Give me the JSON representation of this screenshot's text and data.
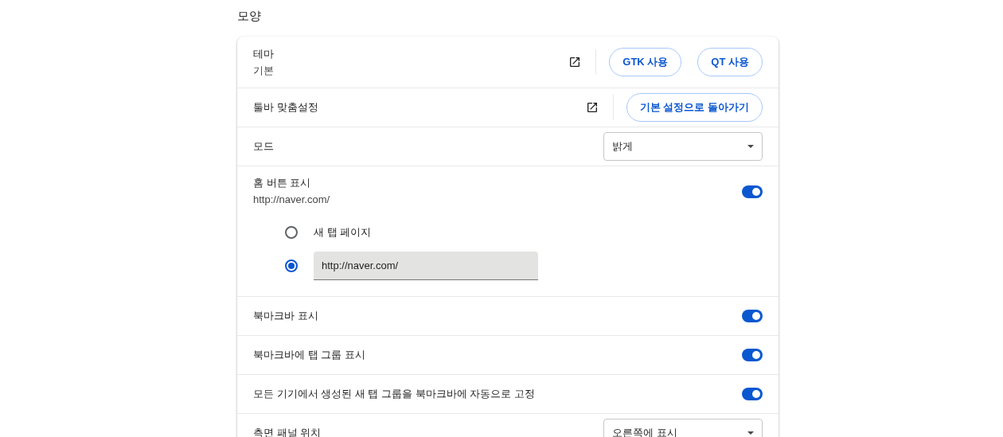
{
  "section_title": "모양",
  "rows": [
    {
      "kind": "links",
      "label": "테마",
      "sublabel": "기본",
      "buttons": [
        "GTK 사용",
        "QT 사용"
      ]
    },
    {
      "kind": "links",
      "label": "툴바 맞춤설정",
      "buttons": [
        "기본 설정으로 돌아가기"
      ]
    },
    {
      "kind": "select",
      "label": "모드",
      "value": "밝게"
    },
    {
      "kind": "toggle",
      "label": "홈 버튼 표시",
      "sublabel": "http://naver.com/",
      "on": true,
      "options": [
        {
          "kind": "radio",
          "label": "새 탭 페이지",
          "selected": false
        },
        {
          "kind": "url",
          "value": "http://naver.com/",
          "selected": true
        }
      ]
    },
    {
      "kind": "toggle",
      "label": "북마크바 표시",
      "on": true
    },
    {
      "kind": "toggle",
      "label": "북마크바에 탭 그룹 표시",
      "on": true
    },
    {
      "kind": "toggle",
      "label": "모든 기기에서 생성된 새 탭 그룹을 북마크바에 자동으로 고정",
      "on": true
    },
    {
      "kind": "select",
      "label": "측면 패널 위치",
      "value": "오른쪽에 표시"
    }
  ]
}
